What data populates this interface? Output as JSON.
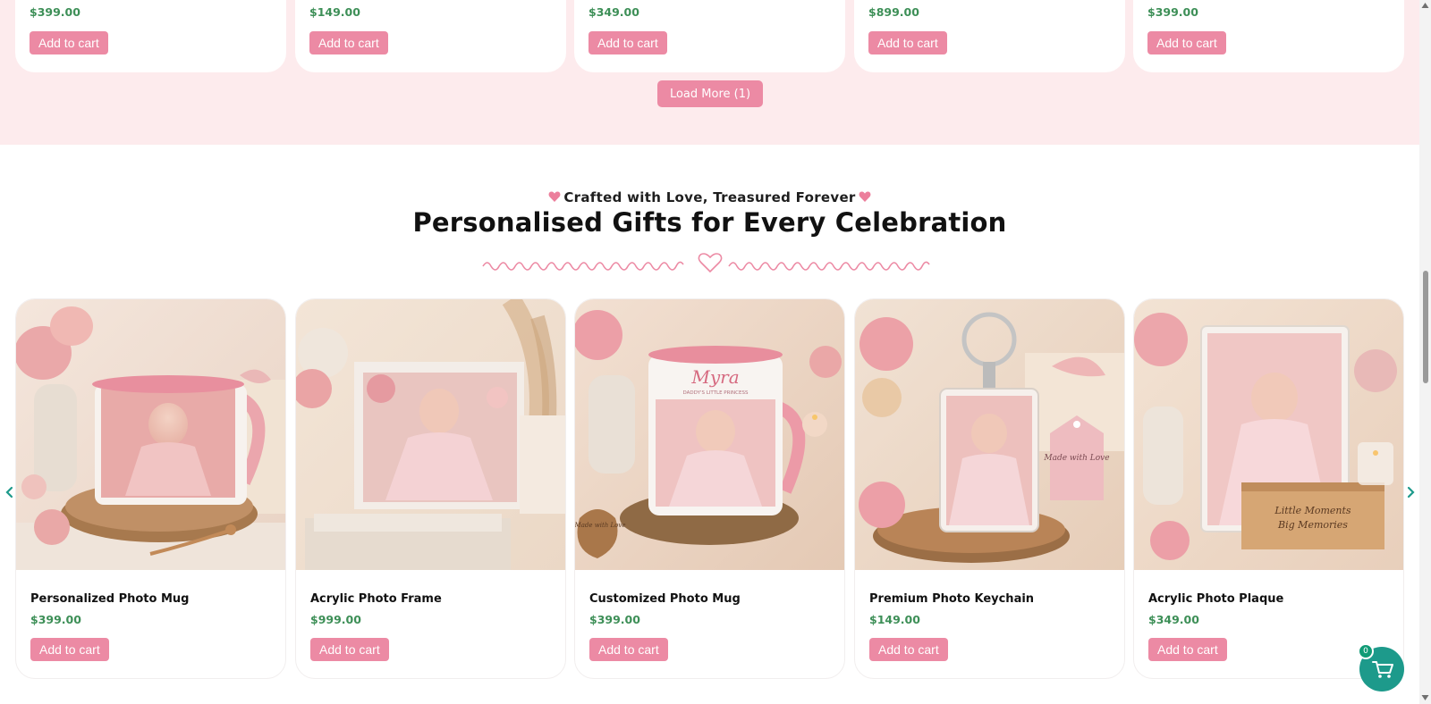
{
  "top_row": {
    "products": [
      {
        "price": "$399.00",
        "button": "Add to cart"
      },
      {
        "price": "$149.00",
        "button": "Add to cart"
      },
      {
        "price": "$349.00",
        "button": "Add to cart"
      },
      {
        "price": "$899.00",
        "button": "Add to cart"
      },
      {
        "price": "$399.00",
        "button": "Add to cart"
      }
    ],
    "load_more": "Load More (1)"
  },
  "section": {
    "eyebrow": "Crafted with Love, Treasured Forever",
    "heading": "Personalised Gifts for Every Celebration"
  },
  "products": [
    {
      "title": "Personalized Photo Mug",
      "price": "$399.00",
      "button": "Add to cart"
    },
    {
      "title": "Acrylic Photo Frame",
      "price": "$999.00",
      "button": "Add to cart"
    },
    {
      "title": "Customized Photo Mug",
      "price": "$399.00",
      "button": "Add to cart"
    },
    {
      "title": "Premium Photo Keychain",
      "price": "$149.00",
      "button": "Add to cart"
    },
    {
      "title": "Acrylic Photo Plaque",
      "price": "$349.00",
      "button": "Add to cart"
    }
  ],
  "image_text": {
    "mug_name": "Myra",
    "mug_tagline": "DADDY'S LITTLE PRINCESS",
    "tag_text": "Made with Love",
    "coaster_text": "Made with Love",
    "plaque_line1": "Little Moments",
    "plaque_line2": "Big Memories"
  },
  "cart": {
    "count": "0"
  },
  "icons": {
    "heart_left": "heart-icon",
    "heart_right": "heart-icon",
    "carousel_prev": "chevron-left-icon",
    "carousel_next": "chevron-right-icon",
    "floating_cart": "cart-icon"
  },
  "colors": {
    "accent_pink": "#ec8aa4",
    "price_green": "#3d8f57",
    "section_bg": "#fdebed",
    "cart_teal": "#1d9a8b"
  }
}
